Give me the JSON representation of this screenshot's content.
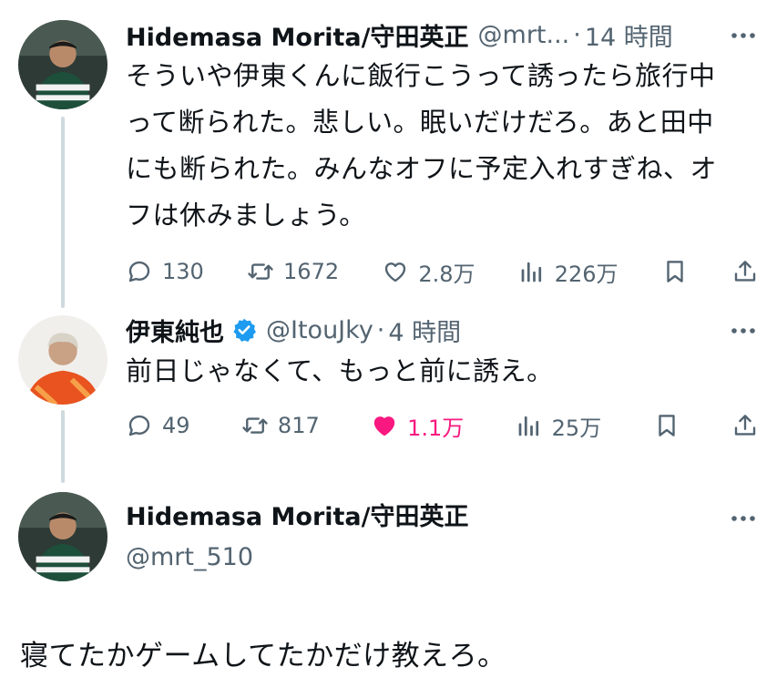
{
  "tweets": [
    {
      "name": "Hidemasa Morita/守田英正",
      "handle": "@mrt...",
      "time": "14 時間",
      "text_lines": [
        "そういや伊東くんに飯行こうって誘ったら旅行中",
        "って断られた。悲しい。眠いだけだろ。あと田中",
        "にも断られた。みんなオフに予定入れすぎね、オ",
        "フは休みましょう。"
      ],
      "replies": "130",
      "reposts": "1672",
      "likes": "2.8万",
      "views": "226万",
      "liked": false
    },
    {
      "name": "伊東純也",
      "handle": "@ItouJky",
      "time": "4 時間",
      "verified": true,
      "text_lines": [
        "前日じゃなくて、もっと前に誘え。"
      ],
      "replies": "49",
      "reposts": "817",
      "likes": "1.1万",
      "views": "25万",
      "liked": true
    }
  ],
  "main_tweet": {
    "name": "Hidemasa Morita/守田英正",
    "handle": "@mrt_510",
    "text": "寝てたかゲームしてたかだけ教えろ。"
  },
  "icons": {
    "reply": "reply-icon",
    "repost": "repost-icon",
    "like": "heart-icon",
    "views": "views-icon",
    "bookmark": "bookmark-icon",
    "share": "share-icon",
    "more": "more-icon",
    "verified": "verified-badge-icon"
  },
  "colors": {
    "text": "#0f1419",
    "secondary": "#536471",
    "like_active": "#f91880",
    "verified": "#1d9bf0",
    "thread_line": "#cfd9de"
  }
}
